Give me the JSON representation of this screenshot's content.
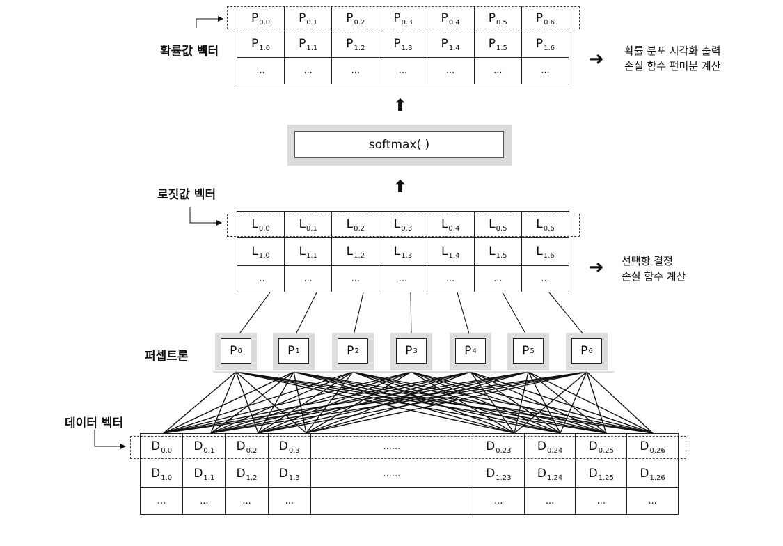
{
  "labels": {
    "prob_vector": "확률값 벡터",
    "logit_vector": "로짓값 벡터",
    "perceptron": "퍼셉트론",
    "data_vector": "데이터 벡터"
  },
  "notes": {
    "prob_line1": "확률 분포 시각화 출력",
    "prob_line2": "손실 함수 편미분 계산",
    "logit_line1": "선택항 결정",
    "logit_line2": "손실 함수 계산"
  },
  "softmax_label": "softmax( )",
  "arrow_glyph": "➜",
  "up_arrow_glyph": "⬆",
  "ellipsis": "...",
  "wide_ellipsis": "......",
  "prob_grid": {
    "letter": "P",
    "row0": [
      "0.0",
      "0.1",
      "0.2",
      "0.3",
      "0.4",
      "0.5",
      "0.6"
    ],
    "row1": [
      "1.0",
      "1.1",
      "1.2",
      "1.3",
      "1.4",
      "1.5",
      "1.6"
    ]
  },
  "logit_grid": {
    "letter": "L",
    "row0": [
      "0.0",
      "0.1",
      "0.2",
      "0.3",
      "0.4",
      "0.5",
      "0.6"
    ],
    "row1": [
      "1.0",
      "1.1",
      "1.2",
      "1.3",
      "1.4",
      "1.5",
      "1.6"
    ]
  },
  "perceptrons": {
    "letter": "P",
    "subs": [
      "0",
      "1",
      "2",
      "3",
      "4",
      "5",
      "6"
    ]
  },
  "data_grid": {
    "letter": "D",
    "row0_left": [
      "0.0",
      "0.1",
      "0.2",
      "0.3"
    ],
    "row0_right": [
      "0.23",
      "0.24",
      "0.25",
      "0.26"
    ],
    "row1_left": [
      "1.0",
      "1.1",
      "1.2",
      "1.3"
    ],
    "row1_right": [
      "1.23",
      "1.24",
      "1.25",
      "1.26"
    ]
  }
}
